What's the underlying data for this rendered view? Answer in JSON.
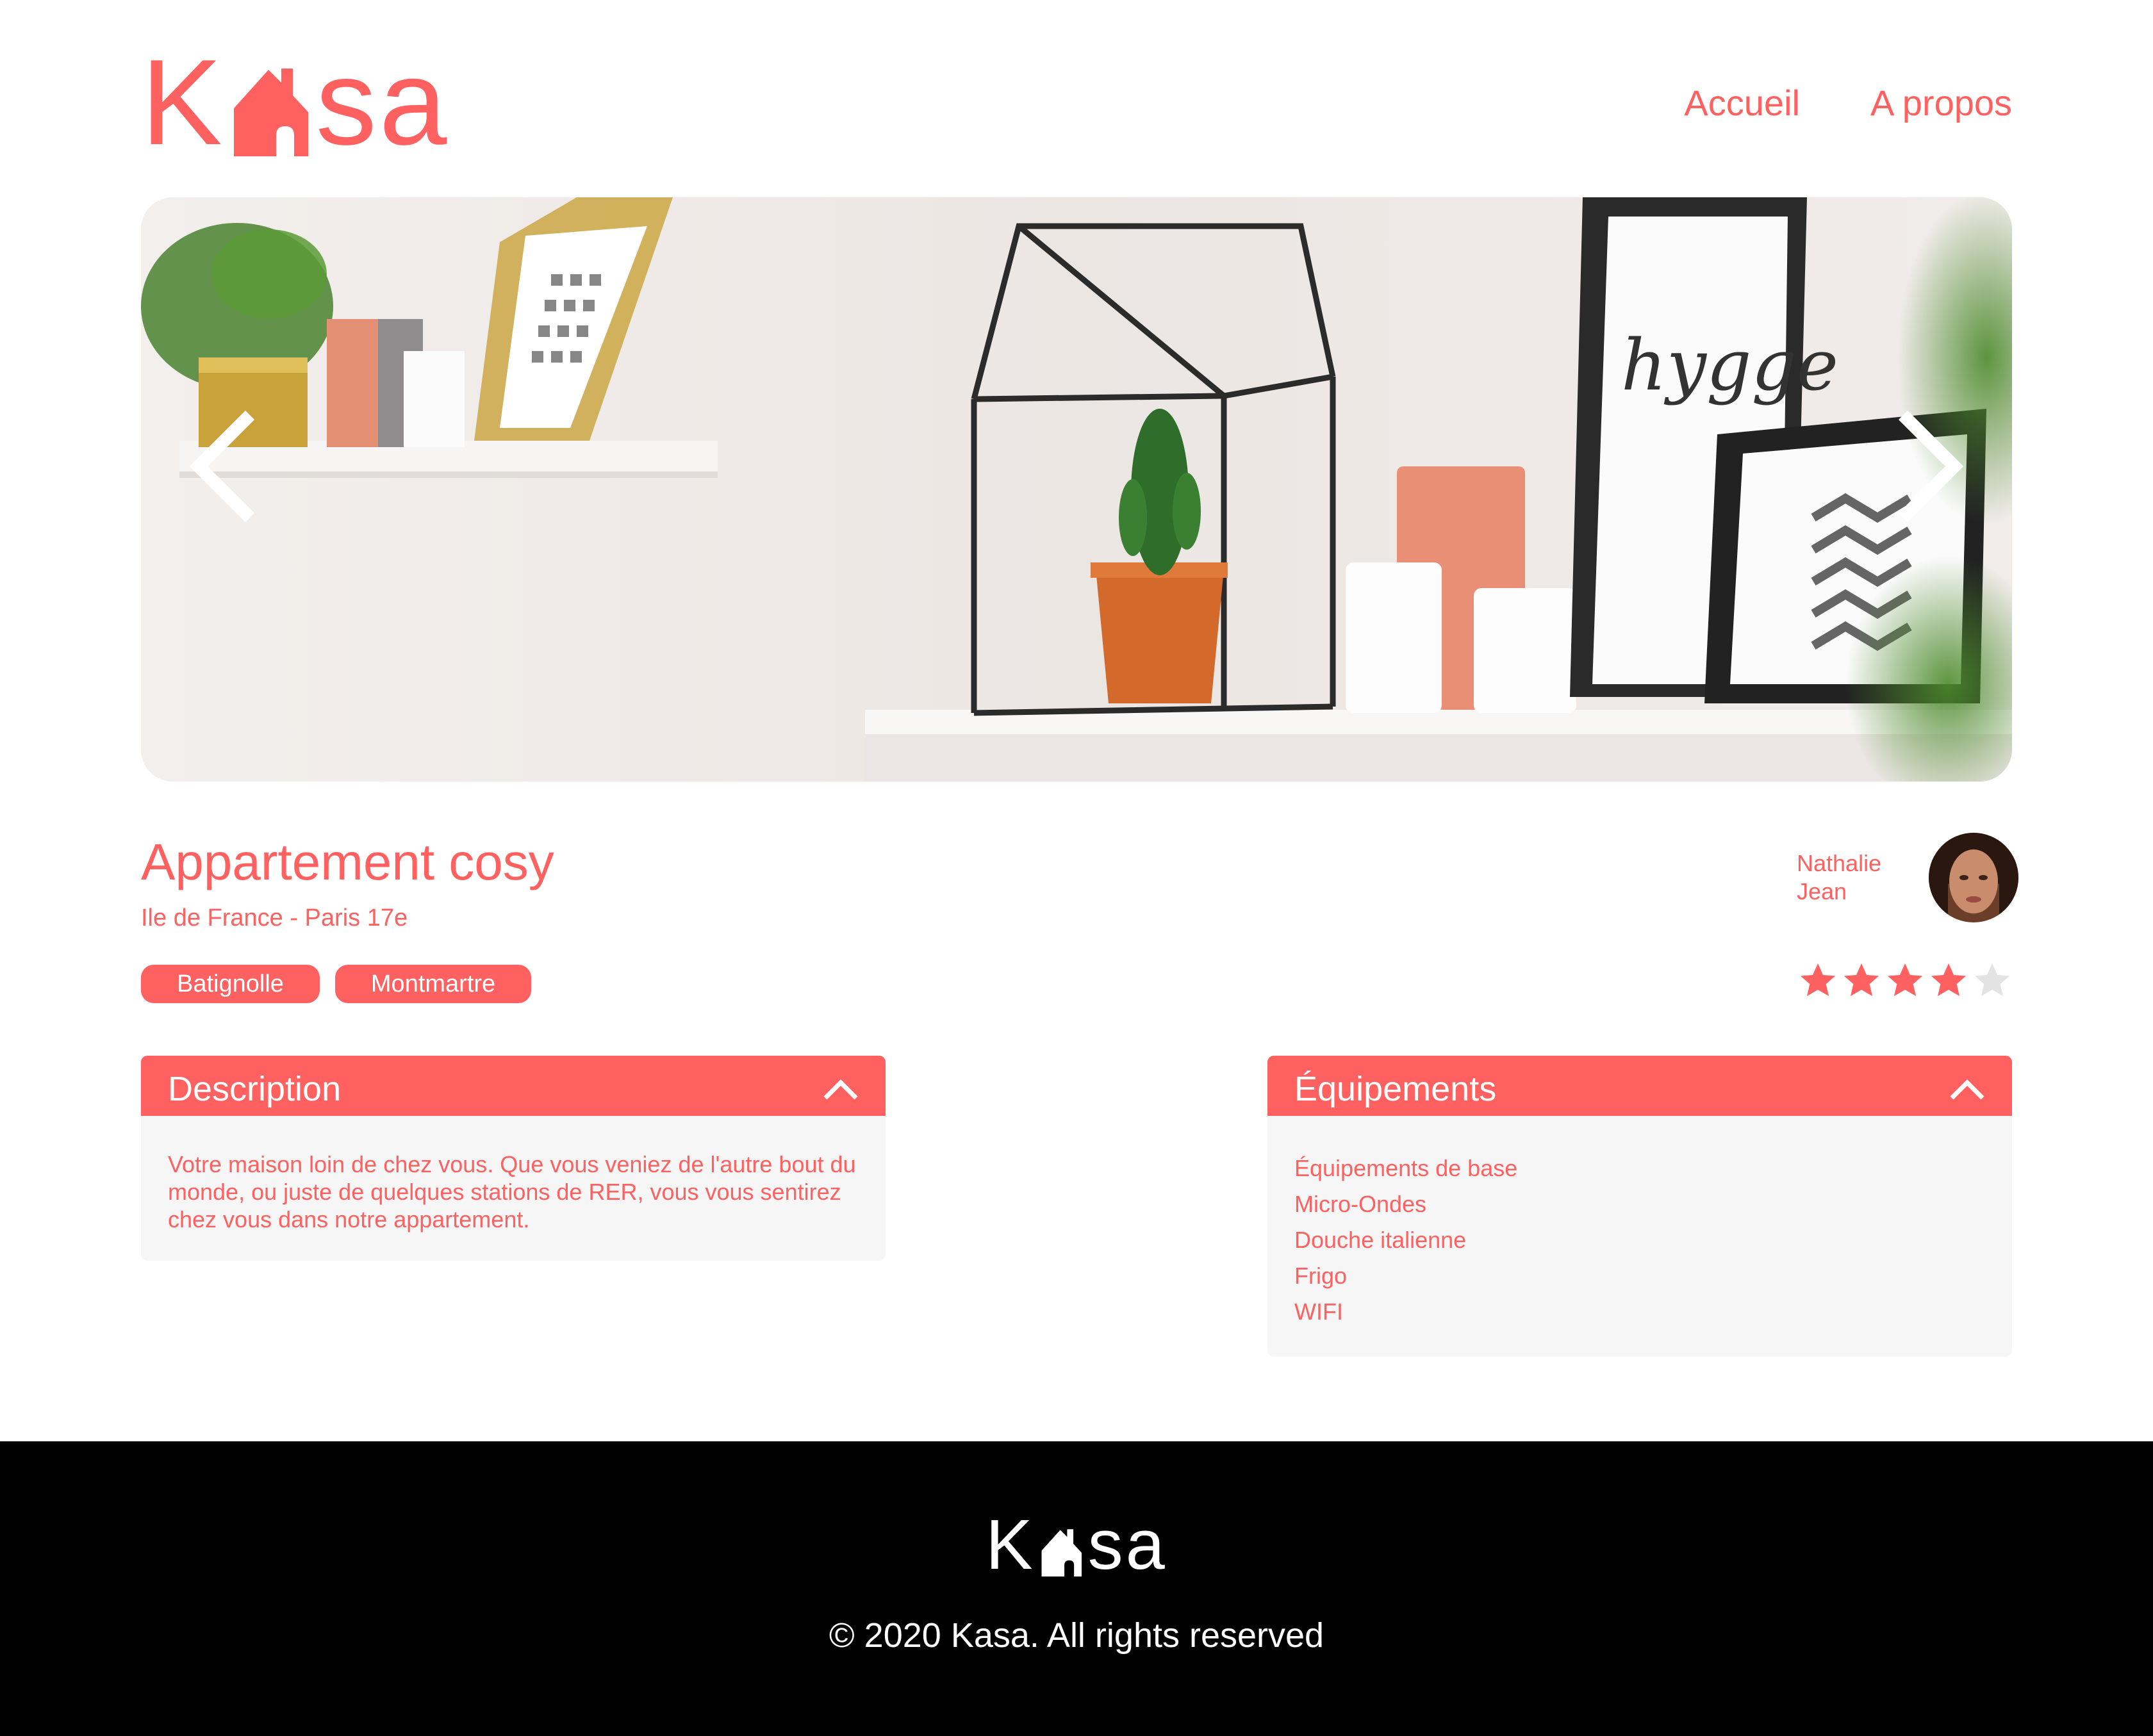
{
  "brand": {
    "logo_prefix": "K",
    "logo_suffix": "sa",
    "color": "#FF6060"
  },
  "nav": {
    "home_label": "Accueil",
    "about_label": "A propos"
  },
  "carousel": {
    "prev_icon": "chevron-left-icon",
    "next_icon": "chevron-right-icon"
  },
  "listing": {
    "title": "Appartement cosy",
    "location": "Ile de France - Paris 17e",
    "tags": [
      "Batignolle",
      "Montmartre"
    ],
    "host": {
      "first_name": "Nathalie",
      "last_name": "Jean"
    },
    "rating": 4,
    "rating_max": 5
  },
  "description": {
    "title": "Description",
    "text": "Votre maison loin de chez vous. Que vous veniez de l'autre bout du monde, ou juste de quelques stations de RER, vous vous sentirez chez vous dans notre appartement."
  },
  "equipments": {
    "title": "Équipements",
    "items": [
      "Équipements de base",
      "Micro-Ondes",
      "Douche italienne",
      "Frigo",
      "WIFI"
    ]
  },
  "footer": {
    "copyright": "© 2020 Kasa. All rights reserved"
  }
}
